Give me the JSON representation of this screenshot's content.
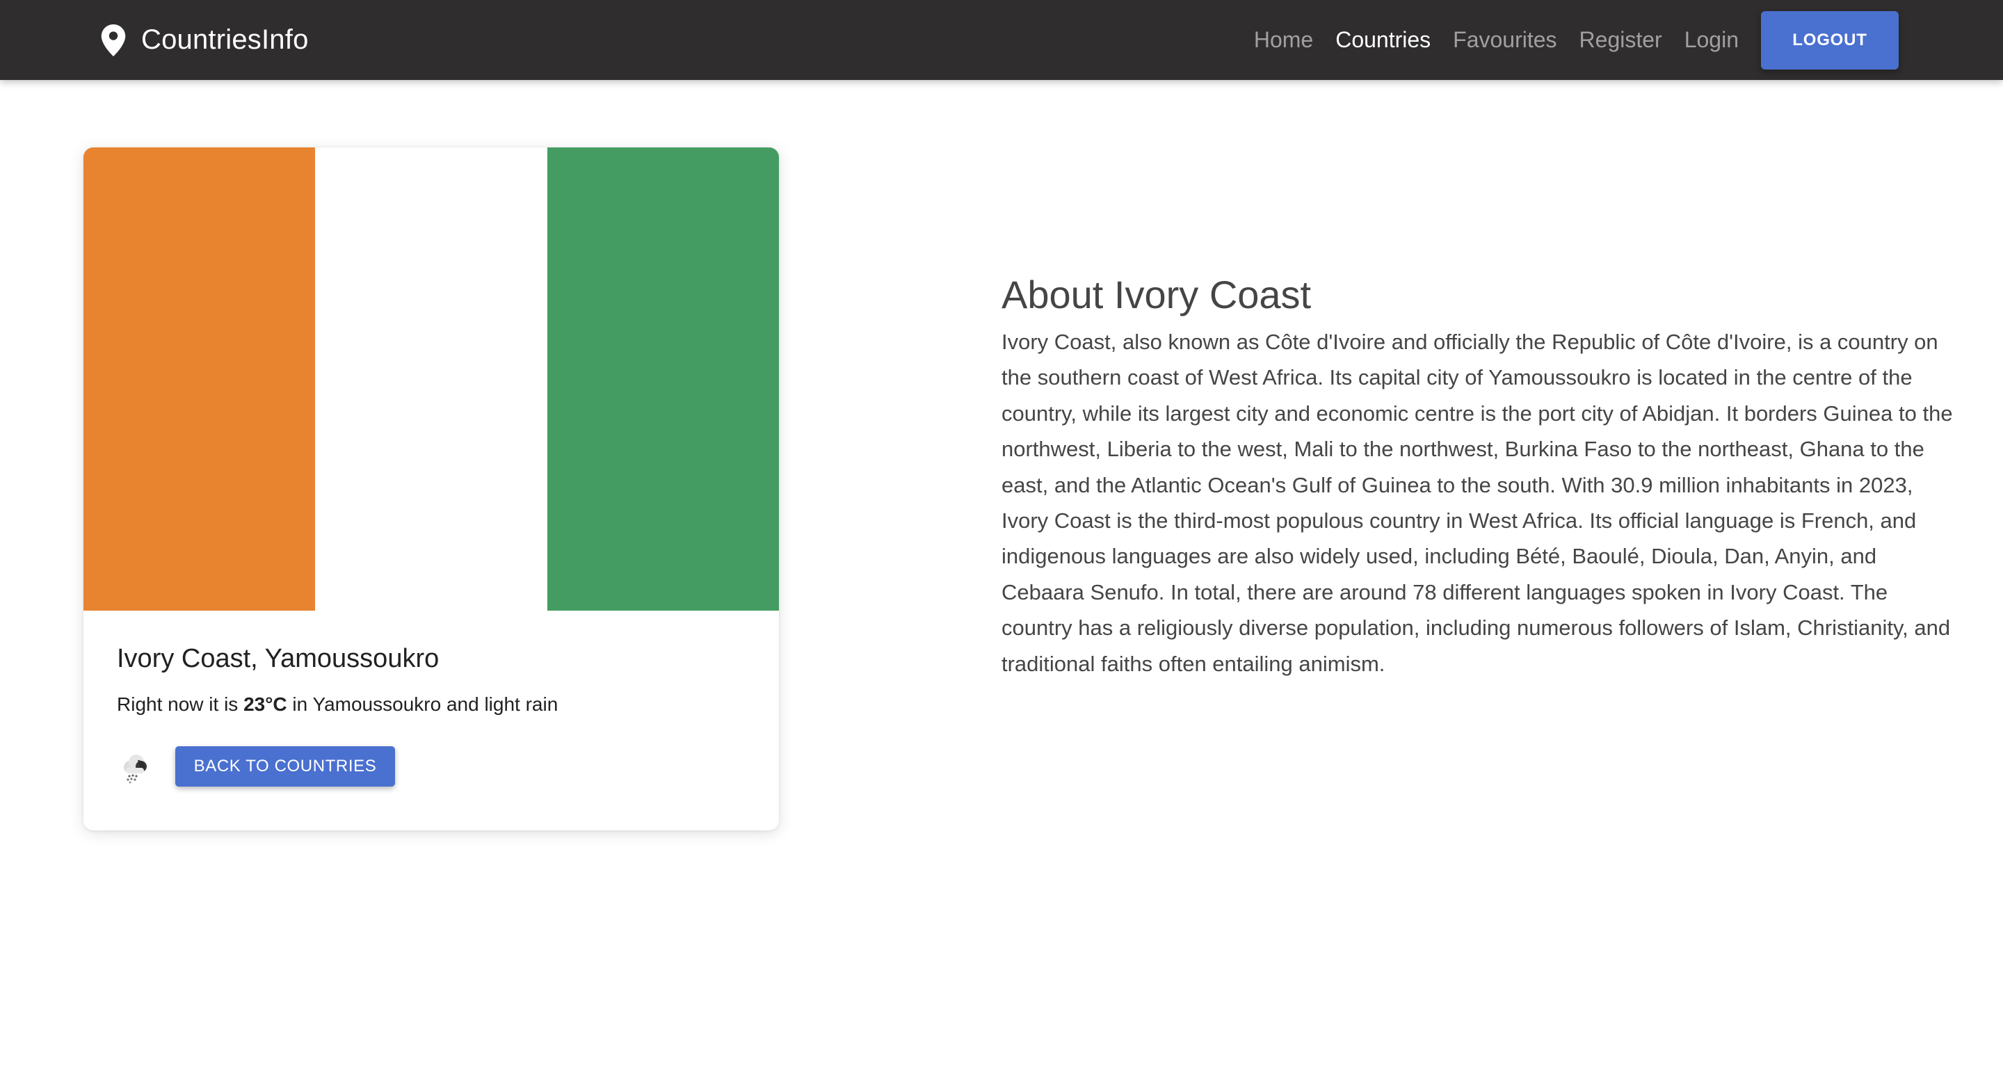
{
  "navbar": {
    "brand": "CountriesInfo",
    "links": [
      {
        "label": "Home"
      },
      {
        "label": "Countries"
      },
      {
        "label": "Favourites"
      },
      {
        "label": "Register"
      },
      {
        "label": "Login"
      }
    ],
    "active_link": "Countries",
    "logout_label": "LOGOUT"
  },
  "country": {
    "flag_colors": [
      "#e8832f",
      "#ffffff",
      "#459c63"
    ],
    "title": "Ivory Coast, Yamoussoukro",
    "weather_prefix": "Right now it is ",
    "temperature": "23°C",
    "weather_suffix": " in Yamoussoukro and light rain",
    "weather_icon": "light-rain-icon",
    "back_label": "BACK TO COUNTRIES"
  },
  "about": {
    "title": "About Ivory Coast",
    "text": "Ivory Coast, also known as Côte d'Ivoire and officially the Republic of Côte d'Ivoire, is a country on the southern coast of West Africa. Its capital city of Yamoussoukro is located in the centre of the country, while its largest city and economic centre is the port city of Abidjan. It borders Guinea to the northwest, Liberia to the west, Mali to the northwest, Burkina Faso to the northeast, Ghana to the east, and the Atlantic Ocean's Gulf of Guinea to the south. With 30.9 million inhabitants in 2023, Ivory Coast is the third-most populous country in West Africa. Its official language is French, and indigenous languages are also widely used, including Bété, Baoulé, Dioula, Dan, Anyin, and Cebaara Senufo. In total, there are around 78 different languages spoken in Ivory Coast. The country has a religiously diverse population, including numerous followers of Islam, Christianity, and traditional faiths often entailing animism."
  },
  "colors": {
    "navbar_bg": "#2f2d2d",
    "accent": "#4a70d0"
  }
}
